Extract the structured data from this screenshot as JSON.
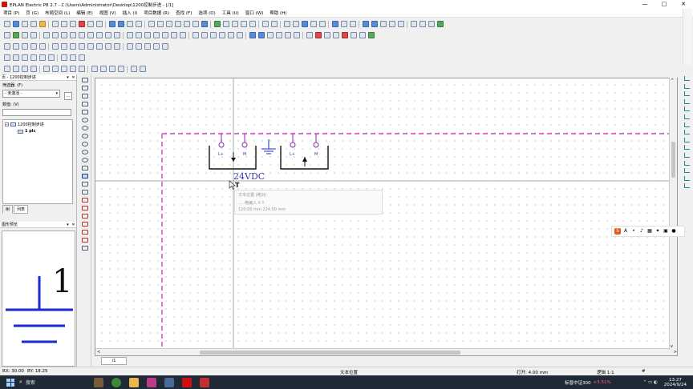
{
  "window": {
    "title": "EPLAN Electric P8 2.7 - C:\\Users\\Administrator\\Desktop\\1200控制步进 - [/1]",
    "controls": [
      "—",
      "□",
      "✕"
    ]
  },
  "menu": [
    "项目 (P)",
    "页 (G)",
    "布局空间 (L)",
    "编辑 (E)",
    "视图 (V)",
    "插入 (I)",
    "项目数据 (R)",
    "查找 (F)",
    "选项 (O)",
    "工具 (U)",
    "窗口 (W)",
    "帮助 (H)"
  ],
  "left_panel": {
    "page_title": "页 - 1200控制步进",
    "filter_label": "筛选器: (F)",
    "filter_value": "- 未激活 -",
    "filter_btn": "...",
    "value_label": "数值: (V)",
    "tree": {
      "root": "1200控制步进",
      "child": "1 plc"
    },
    "tabs": [
      "树",
      "列表"
    ],
    "preview_title": "图形预览",
    "preview_number": "1"
  },
  "canvas": {
    "voltage_label": "24VDC",
    "label_plus": "L+",
    "label_m": "M",
    "cursor_text": "T",
    "tooltip": {
      "title": "文本位置 (绝对)",
      "coords_label": ".... 绝编入 X Y",
      "coords_value": "120.00 mm  224.00 mm"
    }
  },
  "sheet_tab": "/1",
  "status": {
    "rx": "RX: 30.00",
    "ry": "RY: 18.25",
    "center": "文本位置",
    "grid": "打开: 4.00 mm",
    "logic": "逻辑 1:1",
    "hash": "#"
  },
  "taskbar": {
    "search": "搜索",
    "stock": "标普中证300",
    "stock_change": "+3.51%",
    "time": "13:27",
    "date": "2024/9/24"
  },
  "colors": {
    "dash": "#d43fc8",
    "symbol": "#8a2aa8",
    "text_blue": "#3a3aaa"
  }
}
